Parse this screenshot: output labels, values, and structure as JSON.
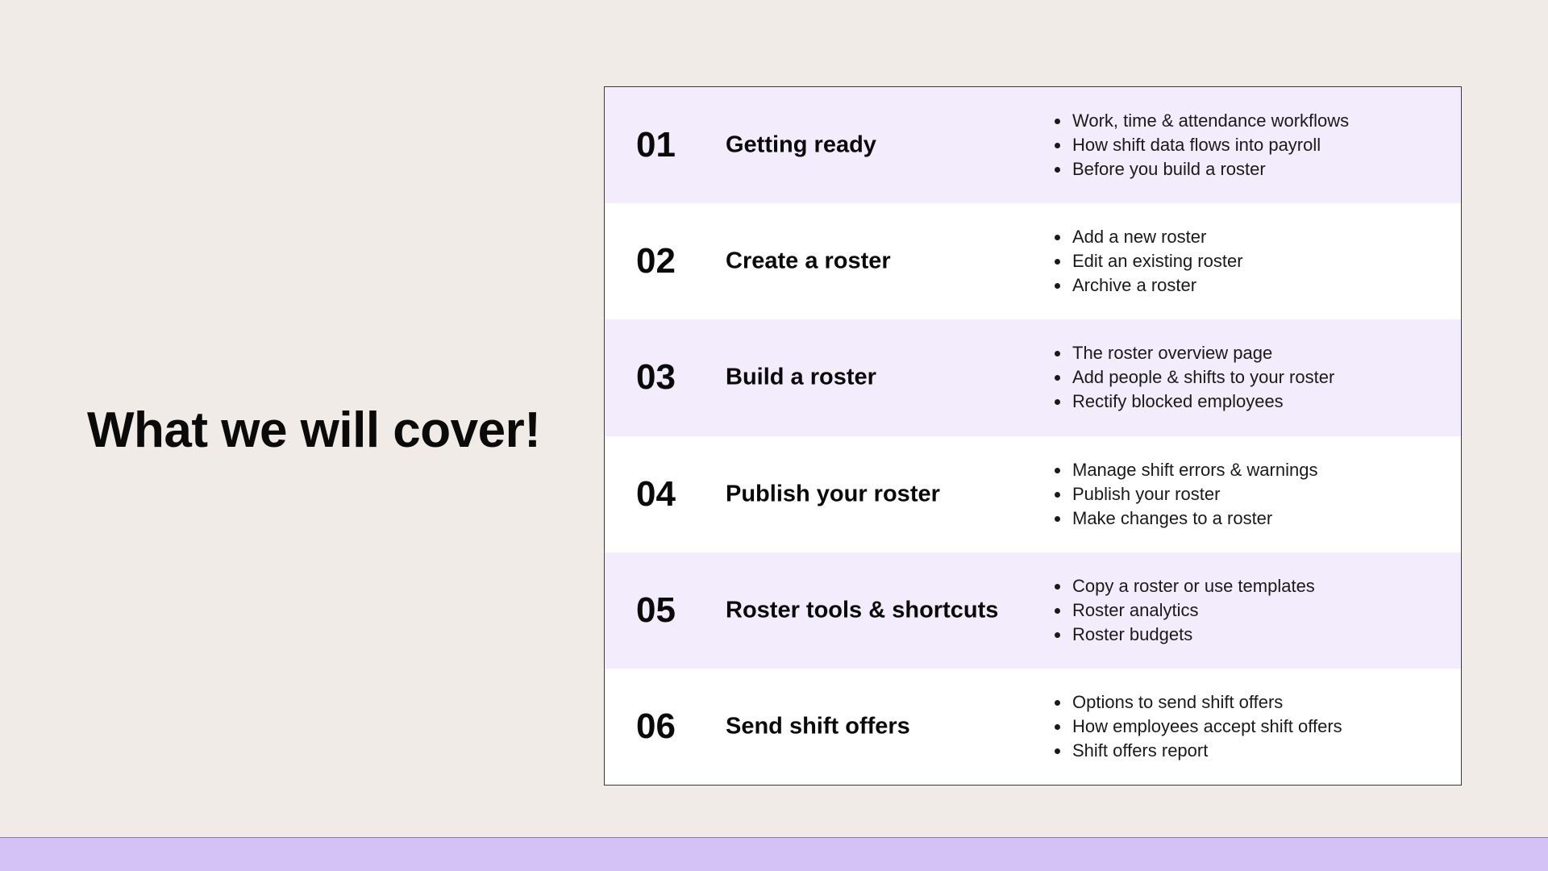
{
  "slide": {
    "title": "What we will cover!"
  },
  "colors": {
    "background": "#f0ebe6",
    "row_shade": "#f2ecfc",
    "footer": "#d4c1f5"
  },
  "agenda": [
    {
      "number": "01",
      "title": "Getting ready",
      "bullets": [
        "Work, time & attendance workflows",
        "How shift data flows into payroll",
        "Before you build a roster"
      ]
    },
    {
      "number": "02",
      "title": "Create a roster",
      "bullets": [
        "Add a new roster",
        "Edit an existing roster",
        "Archive a roster"
      ]
    },
    {
      "number": "03",
      "title": "Build a roster",
      "bullets": [
        "The roster overview page",
        "Add people & shifts to your roster",
        "Rectify blocked employees"
      ]
    },
    {
      "number": "04",
      "title": "Publish your roster",
      "bullets": [
        "Manage shift errors & warnings",
        "Publish your roster",
        "Make changes to a roster"
      ]
    },
    {
      "number": "05",
      "title": "Roster tools & shortcuts",
      "bullets": [
        "Copy a roster or use templates",
        "Roster analytics",
        "Roster budgets"
      ]
    },
    {
      "number": "06",
      "title": "Send shift offers",
      "bullets": [
        "Options to send shift offers",
        "How employees accept shift offers",
        "Shift offers report"
      ]
    }
  ]
}
